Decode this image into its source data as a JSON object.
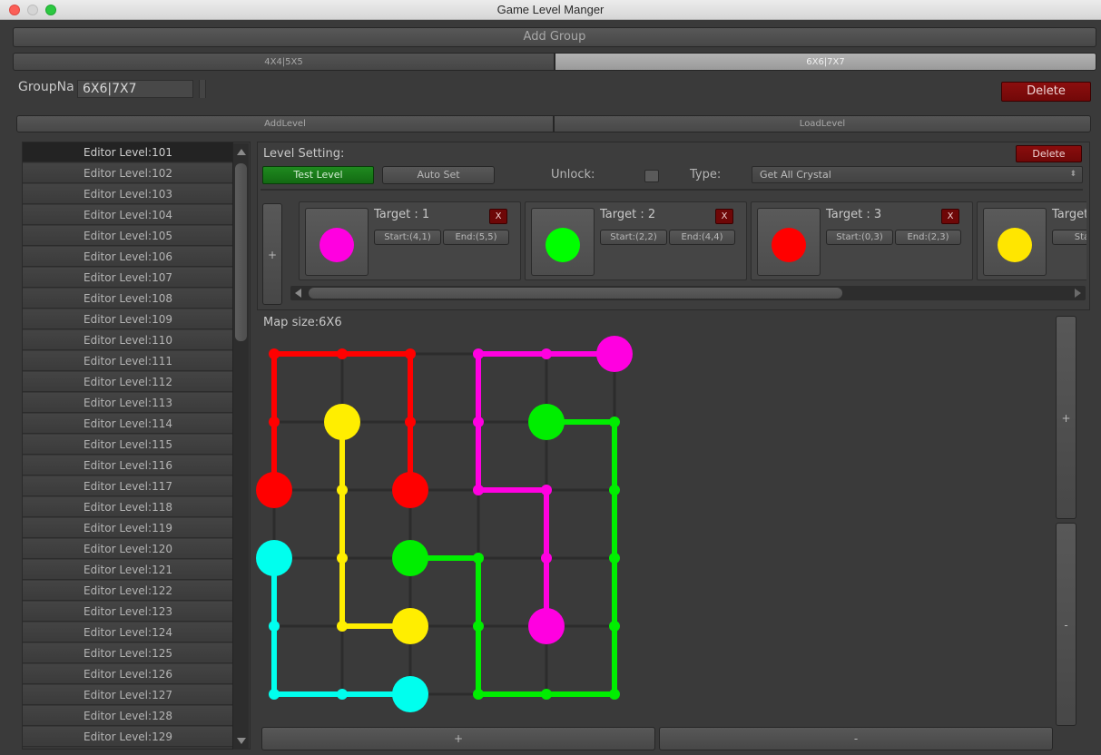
{
  "window": {
    "title": "Game Level Manger"
  },
  "top": {
    "add_group": "Add Group"
  },
  "tabs": [
    {
      "label": "4X4|5X5",
      "active": false
    },
    {
      "label": "6X6|7X7",
      "active": true
    }
  ],
  "group": {
    "name_label": "GroupNa",
    "name_value": "6X6|7X7",
    "delete": "Delete"
  },
  "level_bar": {
    "add": "AddLevel",
    "load": "LoadLevel"
  },
  "levels": [
    "Editor Level:101",
    "Editor Level:102",
    "Editor Level:103",
    "Editor Level:104",
    "Editor Level:105",
    "Editor Level:106",
    "Editor Level:107",
    "Editor Level:108",
    "Editor Level:109",
    "Editor Level:110",
    "Editor Level:111",
    "Editor Level:112",
    "Editor Level:113",
    "Editor Level:114",
    "Editor Level:115",
    "Editor Level:116",
    "Editor Level:117",
    "Editor Level:118",
    "Editor Level:119",
    "Editor Level:120",
    "Editor Level:121",
    "Editor Level:122",
    "Editor Level:123",
    "Editor Level:124",
    "Editor Level:125",
    "Editor Level:126",
    "Editor Level:127",
    "Editor Level:128",
    "Editor Level:129"
  ],
  "selected_level_index": 0,
  "settings": {
    "title": "Level Setting:",
    "delete": "Delete",
    "test_level": "Test Level",
    "auto_set": "Auto Set",
    "unlock_label": "Unlock:",
    "unlock_checked": false,
    "type_label": "Type:",
    "type_value": "Get All Crystal"
  },
  "add_target": "+",
  "targets": [
    {
      "title": "Target : 1",
      "color": "#ff00e0",
      "start": "Start:(4,1)",
      "end": "End:(5,5)",
      "close": "X"
    },
    {
      "title": "Target : 2",
      "color": "#00ff00",
      "start": "Start:(2,2)",
      "end": "End:(4,4)",
      "close": "X"
    },
    {
      "title": "Target : 3",
      "color": "#ff0000",
      "start": "Start:(0,3)",
      "end": "End:(2,3)",
      "close": "X"
    },
    {
      "title": "Target",
      "color": "#ffe600",
      "start": "Start",
      "end": "",
      "close": ""
    }
  ],
  "map": {
    "label": "Map size:6X6",
    "size": 6,
    "grid_color": "#2c2c2c",
    "paths": [
      {
        "color": "#ff0000",
        "cells": [
          [
            0,
            2
          ],
          [
            0,
            1
          ],
          [
            0,
            0
          ],
          [
            1,
            0
          ],
          [
            2,
            0
          ],
          [
            2,
            1
          ],
          [
            2,
            2
          ]
        ]
      },
      {
        "color": "#ffee00",
        "cells": [
          [
            1,
            1
          ],
          [
            1,
            2
          ],
          [
            1,
            3
          ],
          [
            1,
            4
          ],
          [
            2,
            4
          ]
        ]
      },
      {
        "color": "#ff00e0",
        "cells": [
          [
            5,
            0
          ],
          [
            4,
            0
          ],
          [
            3,
            0
          ],
          [
            3,
            1
          ],
          [
            3,
            2
          ],
          [
            4,
            2
          ],
          [
            4,
            3
          ],
          [
            4,
            4
          ]
        ]
      },
      {
        "color": "#00ee00",
        "cells": [
          [
            4,
            1
          ],
          [
            5,
            1
          ],
          [
            5,
            2
          ],
          [
            5,
            3
          ],
          [
            5,
            4
          ],
          [
            5,
            5
          ],
          [
            4,
            5
          ],
          [
            3,
            5
          ],
          [
            3,
            4
          ],
          [
            3,
            3
          ],
          [
            2,
            3
          ]
        ]
      },
      {
        "color": "#00ffee",
        "cells": [
          [
            0,
            3
          ],
          [
            0,
            4
          ],
          [
            0,
            5
          ],
          [
            1,
            5
          ],
          [
            2,
            5
          ]
        ]
      }
    ],
    "endpoints": [
      {
        "color": "#ff0000",
        "cells": [
          [
            0,
            2
          ],
          [
            2,
            2
          ]
        ]
      },
      {
        "color": "#ffee00",
        "cells": [
          [
            1,
            1
          ],
          [
            2,
            4
          ]
        ]
      },
      {
        "color": "#ff00e0",
        "cells": [
          [
            5,
            0
          ],
          [
            4,
            4
          ]
        ]
      },
      {
        "color": "#00ee00",
        "cells": [
          [
            4,
            1
          ],
          [
            2,
            3
          ]
        ]
      },
      {
        "color": "#00ffee",
        "cells": [
          [
            0,
            3
          ],
          [
            2,
            5
          ]
        ]
      }
    ],
    "plus": "+",
    "minus": "-"
  },
  "bottom": {
    "plus": "+",
    "minus": "-"
  }
}
